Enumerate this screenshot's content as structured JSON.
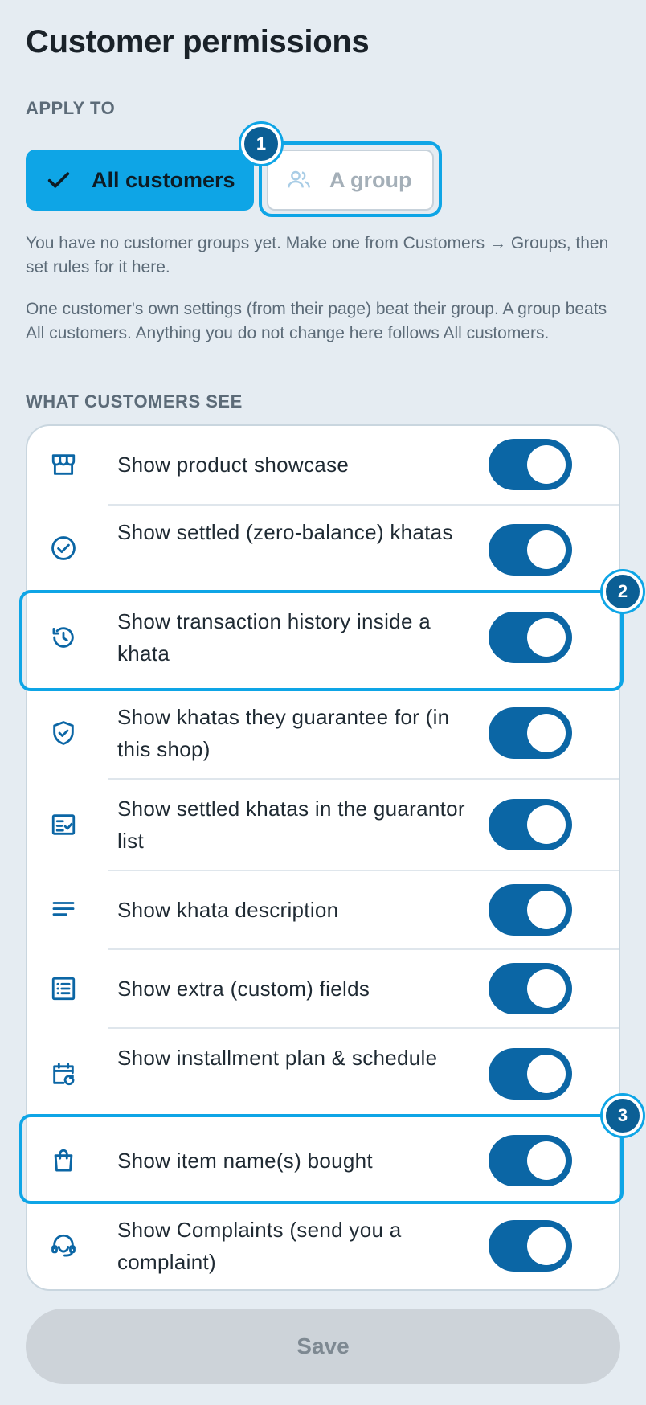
{
  "title": "Customer permissions",
  "apply_to": {
    "label": "APPLY TO",
    "all_customers": "All customers",
    "a_group": "A group",
    "selected": "All customers"
  },
  "help": {
    "no_groups": "You have no customer groups yet. Make one from Customers → Groups, then set rules for it here.",
    "precedence": "One customer's own settings (from their page) beat their group. A group beats All customers. Anything you do not change here follows All customers."
  },
  "what_see": {
    "label": "WHAT CUSTOMERS SEE",
    "items": [
      {
        "label": "Show product showcase",
        "icon": "storefront-icon",
        "on": true
      },
      {
        "label": "Show settled (zero-balance) khatas",
        "icon": "check-circle-icon",
        "on": true
      },
      {
        "label": "Show transaction history inside a khata",
        "icon": "history-icon",
        "on": true
      },
      {
        "label": "Show khatas they guarantee for (in this shop)",
        "icon": "shield-check-icon",
        "on": true
      },
      {
        "label": "Show settled khatas in the guarantor list",
        "icon": "checklist-icon",
        "on": true
      },
      {
        "label": "Show khata description",
        "icon": "notes-icon",
        "on": true
      },
      {
        "label": "Show extra (custom) fields",
        "icon": "list-icon",
        "on": true
      },
      {
        "label": "Show installment plan & schedule",
        "icon": "calendar-repeat-icon",
        "on": true
      },
      {
        "label": "Show item name(s) bought",
        "icon": "shopping-bag-icon",
        "on": true
      },
      {
        "label": "Show Complaints (send you a complaint)",
        "icon": "support-agent-icon",
        "on": true
      }
    ]
  },
  "badges": [
    "1",
    "2",
    "3"
  ],
  "save_label": "Save",
  "colors": {
    "accent": "#0ea5e6",
    "toggle_on": "#0b66a5",
    "badge": "#0b5f95",
    "background": "#e5ecf2"
  }
}
